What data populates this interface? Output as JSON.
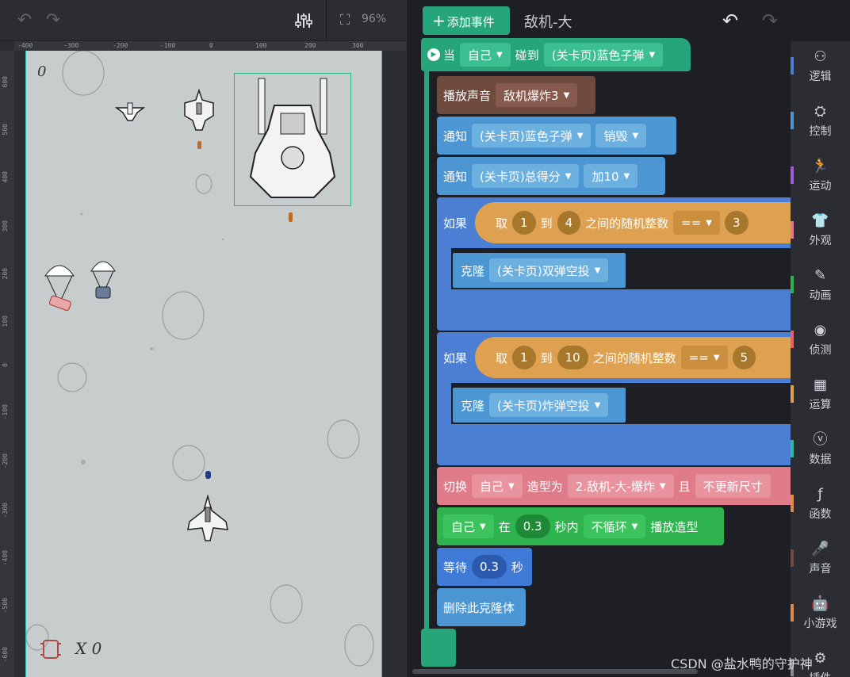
{
  "toolbar": {
    "zoom": "96%"
  },
  "ruler": {
    "top": [
      "-400",
      "-300",
      "-200",
      "-100",
      "0",
      "100",
      "200",
      "300"
    ],
    "left": [
      "600",
      "500",
      "400",
      "300",
      "200",
      "100",
      "0",
      "-100",
      "-200",
      "-300",
      "-400",
      "-500",
      "-600"
    ]
  },
  "stage": {
    "score": "0",
    "lives": "X 0"
  },
  "header": {
    "add_event": "添加事件",
    "sprite_name": "敌机-大"
  },
  "blocks": {
    "hat": {
      "when": "当",
      "self": "自己",
      "touch": "碰到",
      "target": "(关卡页)蓝色子弹"
    },
    "play_sound": {
      "label": "播放声音",
      "sound": "敌机爆炸3"
    },
    "notify1": {
      "label": "通知",
      "target": "(关卡页)蓝色子弹",
      "msg": "销毁"
    },
    "notify2": {
      "label": "通知",
      "target": "(关卡页)总得分",
      "msg": "加10"
    },
    "if1": {
      "label": "如果",
      "take": "取",
      "a": "1",
      "to": "到",
      "b": "4",
      "random": "之间的随机整数",
      "op": "==",
      "value": "3"
    },
    "clone1": {
      "label": "克隆",
      "target": "(关卡页)双弹空投"
    },
    "if2": {
      "label": "如果",
      "take": "取",
      "a": "1",
      "to": "到",
      "b": "10",
      "random": "之间的随机整数",
      "op": "==",
      "value": "5"
    },
    "clone2": {
      "label": "克隆",
      "target": "(关卡页)炸弹空投"
    },
    "switch": {
      "label": "切换",
      "self": "自己",
      "costume_label": "造型为",
      "costume": "2.敌机-大-爆炸",
      "and": "且",
      "option": "不更新尺寸"
    },
    "animate": {
      "self": "自己",
      "in": "在",
      "secs": "0.3",
      "within": "秒内",
      "loop": "不循环",
      "play": "播放造型"
    },
    "wait": {
      "label": "等待",
      "secs": "0.3",
      "unit": "秒"
    },
    "delete": {
      "label": "删除此克隆体"
    }
  },
  "sidebar": {
    "items": [
      {
        "label": "逻辑",
        "icon": "logic-icon",
        "color": "#4b7fd4"
      },
      {
        "label": "控制",
        "icon": "control-icon",
        "color": "#4c97d3"
      },
      {
        "label": "运动",
        "icon": "motion-icon",
        "color": "#a55bd4"
      },
      {
        "label": "外观",
        "icon": "looks-icon",
        "color": "#e07b8a"
      },
      {
        "label": "动画",
        "icon": "animation-icon",
        "color": "#2eb34f"
      },
      {
        "label": "侦测",
        "icon": "sensing-icon",
        "color": "#e0606f"
      },
      {
        "label": "运算",
        "icon": "operator-icon",
        "color": "#dda151"
      },
      {
        "label": "数据",
        "icon": "data-icon",
        "color": "#36b59a"
      },
      {
        "label": "函数",
        "icon": "function-icon",
        "color": "#e08a4a"
      },
      {
        "label": "声音",
        "icon": "sound-icon",
        "color": "#6e4a3f"
      },
      {
        "label": "小游戏",
        "icon": "minigame-icon",
        "color": "#e08a4a"
      },
      {
        "label": "插件",
        "icon": "plugin-icon",
        "color": "#8a8d94"
      }
    ]
  },
  "watermark": "CSDN @盐水鸭的守护神"
}
